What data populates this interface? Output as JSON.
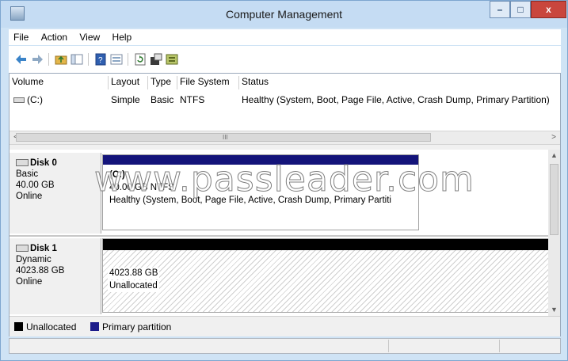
{
  "window": {
    "title": "Computer Management",
    "app_icon": "computer-management-icon",
    "controls": {
      "minimize": "–",
      "maximize": "□",
      "close": "x"
    }
  },
  "menu": {
    "items": [
      "File",
      "Action",
      "View",
      "Help"
    ]
  },
  "toolbar": {
    "icons": [
      "back-arrow-icon",
      "forward-arrow-icon",
      "up-folder-icon",
      "show-hide-tree-icon",
      "help-icon",
      "properties-list-icon",
      "refresh-icon",
      "properties-icon",
      "disk-settings-icon"
    ]
  },
  "volume_table": {
    "columns": [
      "Volume",
      "Layout",
      "Type",
      "File System",
      "Status"
    ],
    "rows": [
      {
        "volume": "(C:)",
        "layout": "Simple",
        "type": "Basic",
        "file_system": "NTFS",
        "status": "Healthy (System, Boot, Page File, Active, Crash Dump, Primary Partition)"
      }
    ],
    "scroll_grip": "III",
    "scroll_left": "<",
    "scroll_right": ">"
  },
  "disks": [
    {
      "name": "Disk 0",
      "type": "Basic",
      "size": "40.00 GB",
      "state": "Online",
      "volume": {
        "label": "(C:)",
        "size_fs": "40.00 GB NTFS",
        "status": "Healthy (System, Boot, Page File, Active, Crash Dump, Primary Partiti"
      }
    },
    {
      "name": "Disk 1",
      "type": "Dynamic",
      "size": "4023.88 GB",
      "state": "Online",
      "volume": {
        "size": "4023.88 GB",
        "status": "Unallocated"
      }
    }
  ],
  "legend": {
    "items": [
      {
        "label": "Unallocated",
        "color": "#000000"
      },
      {
        "label": "Primary partition",
        "color": "#1b1b8a"
      }
    ]
  },
  "colors": {
    "primary_partition": "#14147a",
    "unallocated": "#000000"
  },
  "watermark": "www.passleader.com"
}
